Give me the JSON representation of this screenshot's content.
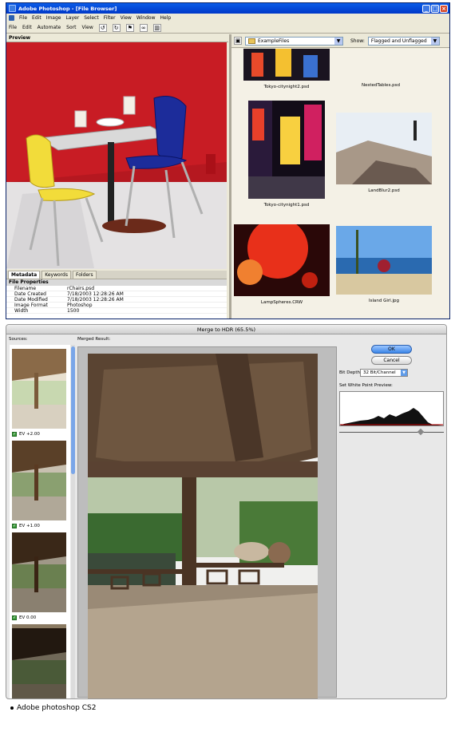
{
  "file_browser": {
    "title": "Adobe Photoshop - [File Browser]",
    "menu": [
      "File",
      "Edit",
      "Image",
      "Layer",
      "Select",
      "Filter",
      "View",
      "Window",
      "Help"
    ],
    "toolbar": [
      "File",
      "Edit",
      "Automate",
      "Sort",
      "View"
    ],
    "preview_tab": "Preview",
    "folder": "ExampleFiles",
    "show_label": "Show:",
    "show_value": "Flagged and Unflagged",
    "meta_tabs": [
      "Metadata",
      "Keywords",
      "Folders"
    ],
    "meta_header": "File Properties",
    "metadata": [
      {
        "key": "Filename",
        "value": "rChairs.psd"
      },
      {
        "key": "Date Created",
        "value": "7/18/2003 12:28:26 AM"
      },
      {
        "key": "Date Modified",
        "value": "7/18/2003 12:28:26 AM"
      },
      {
        "key": "Image Format",
        "value": "Photoshop"
      },
      {
        "key": "Width",
        "value": "1500"
      }
    ],
    "thumbnails": [
      {
        "caption": "Tokyo-citynight2.psd"
      },
      {
        "caption": "NestedTables.psd"
      },
      {
        "caption": "Tokyo-citynight1.psd"
      },
      {
        "caption": "LandBlur2.psd"
      },
      {
        "caption": "LampSpheres.CRW"
      },
      {
        "caption": "Island Girl.jpg"
      }
    ]
  },
  "hdr": {
    "title": "Merge to HDR (65.5%)",
    "sources_label": "Sources:",
    "merged_label": "Merged Result:",
    "sources": [
      {
        "caption": "EV +2.00"
      },
      {
        "caption": "EV +1.00"
      },
      {
        "caption": "EV 0.00"
      }
    ],
    "ok_label": "OK",
    "cancel_label": "Cancel",
    "bit_depth_label": "Bit Depth:",
    "bit_depth_value": "32 Bit/Channel",
    "white_point_label": "Set White Point Preview:"
  },
  "caption": "Adobe photoshop CS2"
}
